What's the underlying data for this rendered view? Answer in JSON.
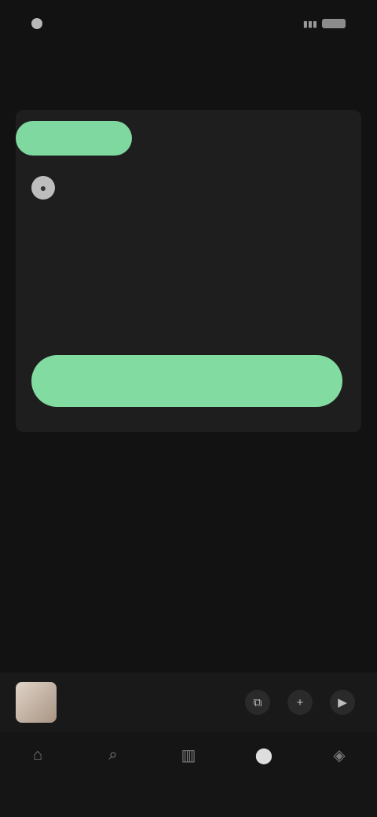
{
  "status_bar": {
    "time": "",
    "battery_icon": "battery-icon",
    "signal_icon": "signal-icon"
  },
  "page": {
    "title": ""
  },
  "card": {
    "chip_label": "",
    "author_name": "",
    "section_title": "",
    "body_lines": [
      "",
      "",
      ""
    ],
    "cta_label": ""
  },
  "mini_player": {
    "title": "",
    "artist": "",
    "controls": [
      "devices-icon",
      "add-icon",
      "play-icon"
    ]
  },
  "bottom_nav": {
    "items": [
      {
        "label": "",
        "icon": "home-icon"
      },
      {
        "label": "",
        "icon": "search-icon"
      },
      {
        "label": "",
        "icon": "library-icon"
      },
      {
        "label": "",
        "icon": "create-icon",
        "active": true
      },
      {
        "label": "",
        "icon": "premium-icon"
      }
    ]
  },
  "colors": {
    "background": "#121212",
    "card": "#1e1e1e",
    "accent": "#82dca2",
    "accent_text": "#66c789"
  }
}
